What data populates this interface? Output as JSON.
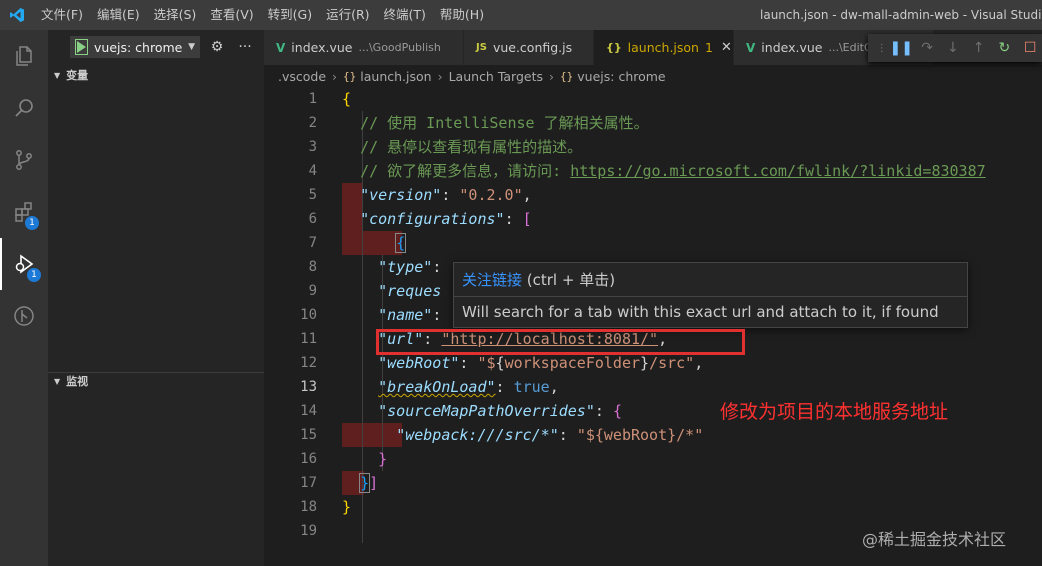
{
  "menu": [
    "文件(F)",
    "编辑(E)",
    "选择(S)",
    "查看(V)",
    "转到(G)",
    "运行(R)",
    "终端(T)",
    "帮助(H)"
  ],
  "window_title": "launch.json - dw-mall-admin-web - Visual Studio",
  "activity": {
    "extensions_badge": "1",
    "debug_badge": "1"
  },
  "sidebar": {
    "config_label": "vuejs: chrome",
    "variables_header": "变量",
    "watch_header": "监视"
  },
  "tabs": [
    {
      "label": "index.vue",
      "desc": "...\\GoodPublish",
      "icon": "V",
      "icon_color": "#41b883"
    },
    {
      "label": "vue.config.js",
      "desc": "",
      "icon": "JS",
      "icon_color": "#cbcb41"
    },
    {
      "label": "launch.json",
      "desc": "",
      "icon": "{}",
      "icon_color": "#cbcb41",
      "count": "1",
      "active": true
    },
    {
      "label": "index.vue",
      "desc": "...\\EditGo",
      "icon": "V",
      "icon_color": "#41b883"
    }
  ],
  "breadcrumb": {
    "folder": ".vscode",
    "file": "launch.json",
    "section": "Launch Targets",
    "item": "vuejs: chrome"
  },
  "line_numbers": [
    "1",
    "2",
    "3",
    "4",
    "5",
    "6",
    "7",
    "8",
    "9",
    "10",
    "11",
    "12",
    "13",
    "14",
    "15",
    "16",
    "17",
    "18",
    "19"
  ],
  "code": {
    "l1_open": "{",
    "l2": "// 使用 IntelliSense 了解相关属性。",
    "l3": "// 悬停以查看现有属性的描述。",
    "l4_prefix": "// 欲了解更多信息，请访问: ",
    "l4_link": "https://go.microsoft.com/fwlink/?linkid=830387",
    "version_key": "\"version\"",
    "version_val": "\"0.2.0\"",
    "configurations_key": "\"configurations\"",
    "type_key": "\"type\"",
    "request_key": "\"reques",
    "name_key": "\"name\"",
    "url_key": "\"url\"",
    "url_val": "\"http://localhost:8081/\"",
    "webroot_key": "\"webRoot\"",
    "webroot_val_a": "\"$",
    "webroot_val_b": "workspaceFolder",
    "webroot_val_c": "/src\"",
    "breakonload_key": "\"breakOnLoad\"",
    "breakonload_val": "true",
    "smpo_key": "\"sourceMapPathOverrides\"",
    "webpack_key": "\"webpack:///src/*\"",
    "webpack_val": "\"${webRoot}/*\""
  },
  "hover": {
    "link_text": "关注链接",
    "shortcut": " (ctrl + 单击)",
    "description": "Will search for a tab with this exact url and attach to it, if found"
  },
  "annotation": "修改为项目的本地服务地址",
  "watermark": "@稀土掘金技术社区"
}
